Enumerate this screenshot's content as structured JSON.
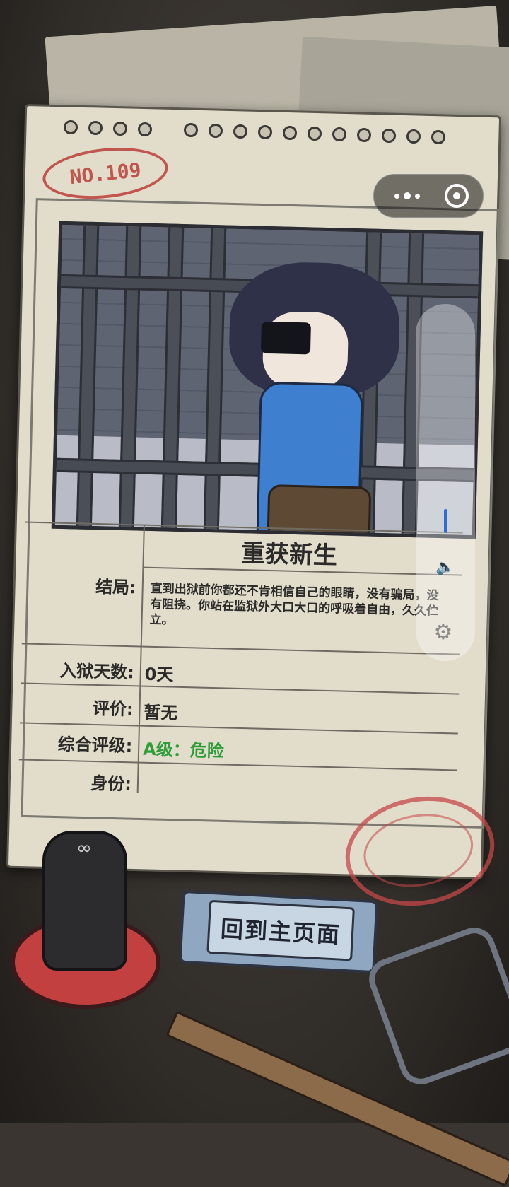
{
  "game": {
    "record_number": "NO.109",
    "ending": {
      "label": "结局:",
      "title": "重获新生",
      "description": "直到出狱前你都还不肯相信自己的眼睛，没有骗局，没有阻挠。你站在监狱外大口大口的呼吸着自由，久久伫立。"
    },
    "days": {
      "label": "入狱天数:",
      "value": "0天"
    },
    "evaluation": {
      "label": "评价:",
      "value": "暂无"
    },
    "overall_grade": {
      "label": "综合评级:",
      "value": "A级：危险",
      "color": "#2f9e3a"
    },
    "identity": {
      "label": "身份:",
      "value": ""
    },
    "home_button": "回到主页面"
  },
  "icons": [
    "more-icon",
    "close-icon",
    "speaker-icon",
    "gear-icon",
    "infinity-icon"
  ]
}
